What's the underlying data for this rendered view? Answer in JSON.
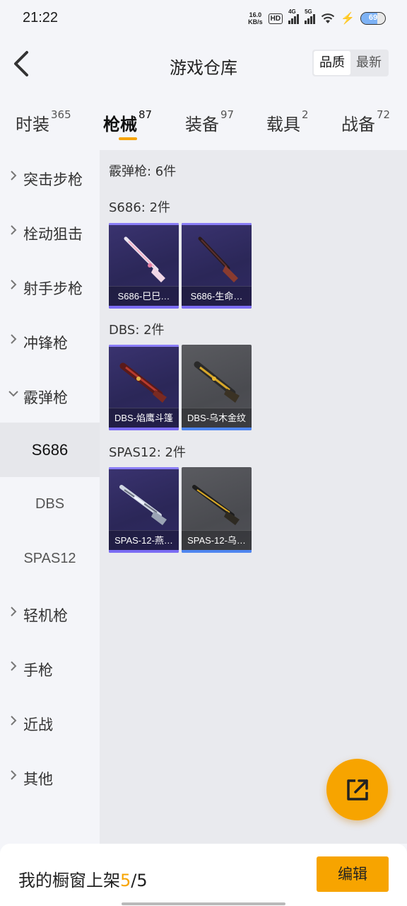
{
  "status_bar": {
    "time": "21:22",
    "net_speed_value": "16.0",
    "net_speed_unit": "KB/s",
    "hd_label": "HD",
    "signal1_label": "4G",
    "signal2_label": "5G",
    "battery": "69",
    "battery_level": 0.69
  },
  "header": {
    "title": "游戏仓库",
    "sort_options": [
      "品质",
      "最新"
    ],
    "sort_selected": "品质"
  },
  "tabs": [
    {
      "label": "时装",
      "count": "365"
    },
    {
      "label": "枪械",
      "count": "87",
      "active": true
    },
    {
      "label": "装备",
      "count": "97"
    },
    {
      "label": "载具",
      "count": "2"
    },
    {
      "label": "战备",
      "count": "72"
    }
  ],
  "sidebar": {
    "categories": [
      "突击步枪",
      "栓动狙击",
      "射手步枪",
      "冲锋枪",
      "霰弹枪"
    ],
    "expanded_category": "霰弹枪",
    "sub_items": [
      "S686",
      "DBS",
      "SPAS12"
    ],
    "selected_sub": "S686",
    "more_categories": [
      "轻机枪",
      "手枪",
      "近战",
      "其他"
    ]
  },
  "content": {
    "summary": "霰弹枪: 6件",
    "groups": [
      {
        "title": "S686: 2件",
        "items": [
          {
            "name": "S686-巳巳…",
            "rarity": "purple",
            "icon": "shotgun-s686-icon"
          },
          {
            "name": "S686-生命…",
            "rarity": "purple",
            "icon": "shotgun-s686-icon"
          }
        ]
      },
      {
        "title": "DBS: 2件",
        "items": [
          {
            "name": "DBS-焰鹰斗篷",
            "rarity": "purple",
            "icon": "shotgun-dbs-icon"
          },
          {
            "name": "DBS-乌木金纹",
            "rarity": "grey",
            "icon": "shotgun-dbs-icon"
          }
        ]
      },
      {
        "title": "SPAS12: 2件",
        "items": [
          {
            "name": "SPAS-12-燕…",
            "rarity": "purple",
            "icon": "shotgun-spas12-icon"
          },
          {
            "name": "SPAS-12-乌…",
            "rarity": "grey",
            "icon": "shotgun-spas12-icon"
          }
        ]
      }
    ]
  },
  "bottom_bar": {
    "showcase_label": "我的橱窗上架",
    "showcase_current": "5",
    "showcase_sep_total": "/5",
    "edit_label": "编辑"
  },
  "fab": {
    "icon": "share-export-icon"
  },
  "colors": {
    "accent": "#f7a400",
    "purple_card": "#2b2758",
    "grey_card": "#4a4b50",
    "purple_bar": "#7b6cf3",
    "blue_bar": "#4f86f0"
  }
}
